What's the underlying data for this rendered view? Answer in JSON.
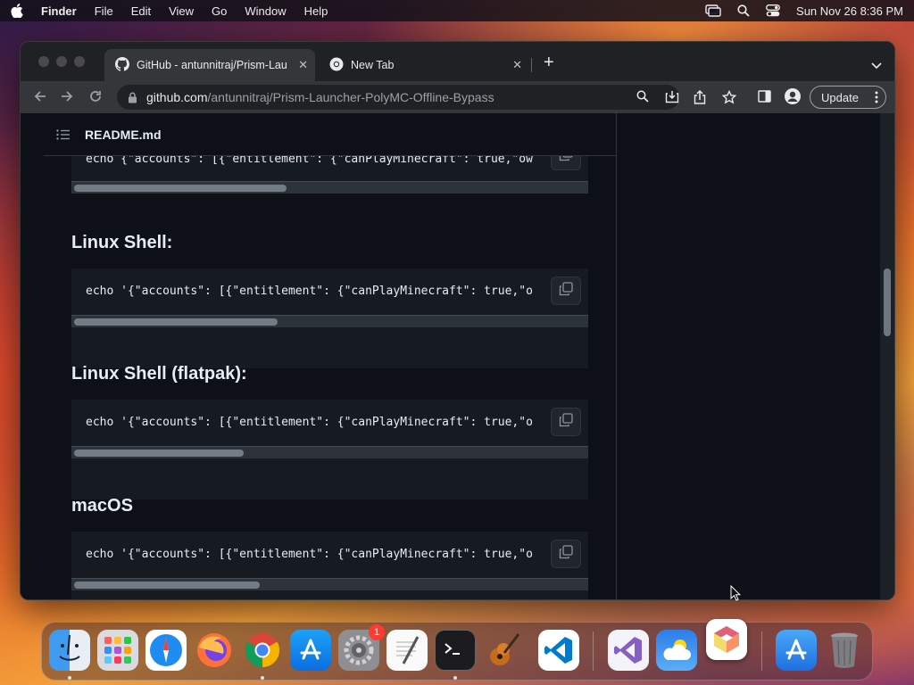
{
  "menubar": {
    "app_name": "Finder",
    "items": [
      "File",
      "Edit",
      "View",
      "Go",
      "Window",
      "Help"
    ],
    "clock": "Sun Nov 26  8:36 PM"
  },
  "browser": {
    "tabs": [
      {
        "title": "GitHub - antunnitraj/Prism-Lau",
        "icon": "github-icon",
        "active": true
      },
      {
        "title": "New Tab",
        "icon": "chrome-icon",
        "active": false
      }
    ],
    "url_host": "github.com",
    "url_path": "/antunnitraj/Prism-Launcher-PolyMC-Offline-Bypass",
    "update_label": "Update"
  },
  "readme": {
    "file_name": "README.md",
    "top_code": "echo {\"accounts\": [{\"entitlement\": {\"canPlayMinecraft\": true,\"ow",
    "sections": [
      {
        "heading": "Linux Shell:",
        "code": "echo '{\"accounts\": [{\"entitlement\": {\"canPlayMinecraft\": true,\"o"
      },
      {
        "heading": "Linux Shell (flatpak):",
        "code": "echo '{\"accounts\": [{\"entitlement\": {\"canPlayMinecraft\": true,\"o"
      },
      {
        "heading": "macOS",
        "code": "echo '{\"accounts\": [{\"entitlement\": {\"canPlayMinecraft\": true,\"o"
      }
    ]
  },
  "dock": {
    "apps": [
      "Finder",
      "Launchpad",
      "Safari",
      "Firefox",
      "Google Chrome",
      "App Store",
      "System Settings",
      "TextEdit",
      "Terminal",
      "GarageBand",
      "Visual Studio Code",
      "Visual Studio",
      "Weather",
      "Prism Launcher",
      "Applications",
      "Trash"
    ],
    "settings_badge": "1"
  }
}
